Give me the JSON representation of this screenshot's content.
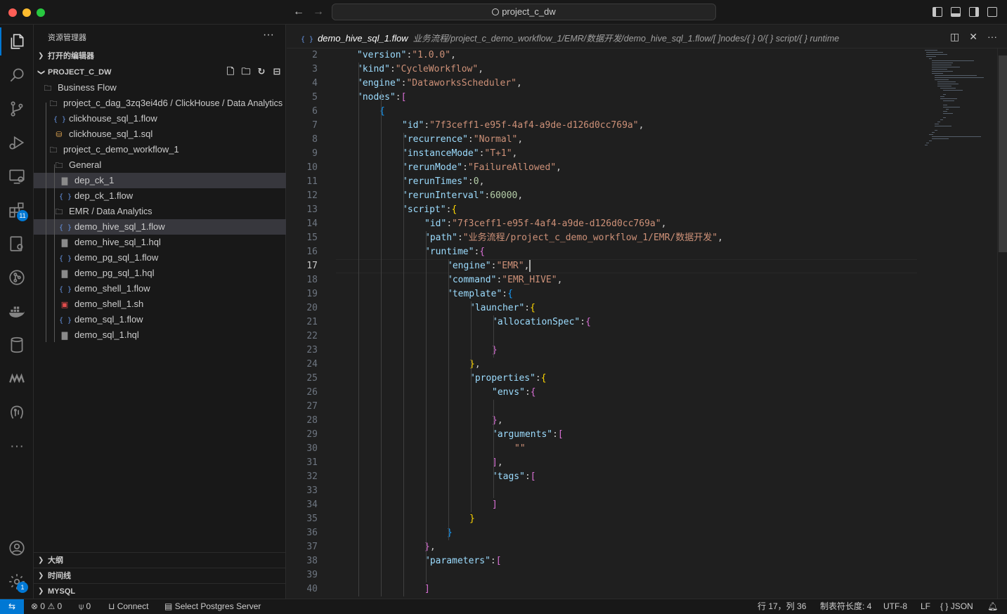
{
  "window": {
    "search_text": "project_c_dw"
  },
  "activity": {
    "extensions_badge": "11",
    "settings_badge": "1"
  },
  "sidebar": {
    "title": "资源管理器",
    "open_editors": "打开的编辑器",
    "project": "PROJECT_C_DW",
    "outline": "大纲",
    "timeline": "时间线",
    "mysql": "MYSQL",
    "tree": [
      {
        "label": "Business Flow",
        "icon": "folder-icon"
      },
      {
        "label": "project_c_dag_3zq3ei4d6",
        "sub": " / ClickHouse / Data Analytics",
        "icon": "folder-icon"
      },
      {
        "label": "clickhouse_sql_1.flow",
        "icon": "json-icon"
      },
      {
        "label": "clickhouse_sql_1.sql",
        "icon": "database-icon"
      },
      {
        "label": "project_c_demo_workflow_1",
        "icon": "folder-icon"
      },
      {
        "label": "General",
        "icon": "folder-icon"
      },
      {
        "label": "dep_ck_1",
        "icon": "file-icon"
      },
      {
        "label": "dep_ck_1.flow",
        "icon": "json-icon"
      },
      {
        "label": "EMR",
        "sub": " / Data Analytics",
        "icon": "folder-icon"
      },
      {
        "label": "demo_hive_sql_1.flow",
        "icon": "json-icon"
      },
      {
        "label": "demo_hive_sql_1.hql",
        "icon": "file-icon"
      },
      {
        "label": "demo_pg_sql_1.flow",
        "icon": "json-icon"
      },
      {
        "label": "demo_pg_sql_1.hql",
        "icon": "file-icon"
      },
      {
        "label": "demo_shell_1.flow",
        "icon": "json-icon"
      },
      {
        "label": "demo_shell_1.sh",
        "icon": "shell-icon"
      },
      {
        "label": "demo_sql_1.flow",
        "icon": "json-icon"
      },
      {
        "label": "demo_sql_1.hql",
        "icon": "file-icon"
      }
    ]
  },
  "editor": {
    "file_name": "demo_hive_sql_1.flow",
    "breadcrumb_path": "业务流程/project_c_demo_workflow_1/EMR/数据开发/demo_hive_sql_1.flow/[ ]nodes/{ } 0/{ } script/{ } runtime",
    "current_line": "17",
    "lines": [
      {
        "n": "2",
        "indent": 1,
        "tokens": [
          [
            "k",
            "\"version\""
          ],
          [
            "p",
            ":"
          ],
          [
            "s",
            "\"1.0.0\""
          ],
          [
            "p",
            ","
          ]
        ]
      },
      {
        "n": "3",
        "indent": 1,
        "tokens": [
          [
            "k",
            "\"kind\""
          ],
          [
            "p",
            ":"
          ],
          [
            "s",
            "\"CycleWorkflow\""
          ],
          [
            "p",
            ","
          ]
        ]
      },
      {
        "n": "4",
        "indent": 1,
        "tokens": [
          [
            "k",
            "\"engine\""
          ],
          [
            "p",
            ":"
          ],
          [
            "s",
            "\"DataworksScheduler\""
          ],
          [
            "p",
            ","
          ]
        ]
      },
      {
        "n": "5",
        "indent": 1,
        "tokens": [
          [
            "k",
            "\"nodes\""
          ],
          [
            "p",
            ":"
          ],
          [
            "b2",
            "["
          ]
        ]
      },
      {
        "n": "6",
        "indent": 2,
        "tokens": [
          [
            "b3",
            "{"
          ]
        ]
      },
      {
        "n": "7",
        "indent": 3,
        "tokens": [
          [
            "k",
            "\"id\""
          ],
          [
            "p",
            ":"
          ],
          [
            "s",
            "\"7f3ceff1-e95f-4af4-a9de-d126d0cc769a\""
          ],
          [
            "p",
            ","
          ]
        ]
      },
      {
        "n": "8",
        "indent": 3,
        "tokens": [
          [
            "k",
            "\"recurrence\""
          ],
          [
            "p",
            ":"
          ],
          [
            "s",
            "\"Normal\""
          ],
          [
            "p",
            ","
          ]
        ]
      },
      {
        "n": "9",
        "indent": 3,
        "tokens": [
          [
            "k",
            "\"instanceMode\""
          ],
          [
            "p",
            ":"
          ],
          [
            "s",
            "\"T+1\""
          ],
          [
            "p",
            ","
          ]
        ]
      },
      {
        "n": "10",
        "indent": 3,
        "tokens": [
          [
            "k",
            "\"rerunMode\""
          ],
          [
            "p",
            ":"
          ],
          [
            "s",
            "\"FailureAllowed\""
          ],
          [
            "p",
            ","
          ]
        ]
      },
      {
        "n": "11",
        "indent": 3,
        "tokens": [
          [
            "k",
            "\"rerunTimes\""
          ],
          [
            "p",
            ":"
          ],
          [
            "n",
            "0"
          ],
          [
            "p",
            ","
          ]
        ]
      },
      {
        "n": "12",
        "indent": 3,
        "tokens": [
          [
            "k",
            "\"rerunInterval\""
          ],
          [
            "p",
            ":"
          ],
          [
            "n",
            "60000"
          ],
          [
            "p",
            ","
          ]
        ]
      },
      {
        "n": "13",
        "indent": 3,
        "tokens": [
          [
            "k",
            "\"script\""
          ],
          [
            "p",
            ":"
          ],
          [
            "b1",
            "{"
          ]
        ]
      },
      {
        "n": "14",
        "indent": 4,
        "tokens": [
          [
            "k",
            "\"id\""
          ],
          [
            "p",
            ":"
          ],
          [
            "s",
            "\"7f3ceff1-e95f-4af4-a9de-d126d0cc769a\""
          ],
          [
            "p",
            ","
          ]
        ]
      },
      {
        "n": "15",
        "indent": 4,
        "tokens": [
          [
            "k",
            "\"path\""
          ],
          [
            "p",
            ":"
          ],
          [
            "s",
            "\"业务流程/project_c_demo_workflow_1/EMR/数据开发\""
          ],
          [
            "p",
            ","
          ]
        ]
      },
      {
        "n": "16",
        "indent": 4,
        "tokens": [
          [
            "k",
            "\"runtime\""
          ],
          [
            "p",
            ":"
          ],
          [
            "b2",
            "{"
          ]
        ]
      },
      {
        "n": "17",
        "indent": 5,
        "tokens": [
          [
            "k",
            "\"engine\""
          ],
          [
            "p",
            ":"
          ],
          [
            "s",
            "\"EMR\""
          ],
          [
            "p",
            ","
          ]
        ],
        "cursor": true
      },
      {
        "n": "18",
        "indent": 5,
        "tokens": [
          [
            "k",
            "\"command\""
          ],
          [
            "p",
            ":"
          ],
          [
            "s",
            "\"EMR_HIVE\""
          ],
          [
            "p",
            ","
          ]
        ]
      },
      {
        "n": "19",
        "indent": 5,
        "tokens": [
          [
            "k",
            "\"template\""
          ],
          [
            "p",
            ":"
          ],
          [
            "b3",
            "{"
          ]
        ]
      },
      {
        "n": "20",
        "indent": 6,
        "tokens": [
          [
            "k",
            "\"launcher\""
          ],
          [
            "p",
            ":"
          ],
          [
            "b1",
            "{"
          ]
        ]
      },
      {
        "n": "21",
        "indent": 7,
        "tokens": [
          [
            "k",
            "\"allocationSpec\""
          ],
          [
            "p",
            ":"
          ],
          [
            "b2",
            "{"
          ]
        ]
      },
      {
        "n": "22",
        "indent": 0,
        "tokens": []
      },
      {
        "n": "23",
        "indent": 7,
        "tokens": [
          [
            "b2",
            "}"
          ]
        ]
      },
      {
        "n": "24",
        "indent": 6,
        "tokens": [
          [
            "b1",
            "}"
          ],
          [
            "p",
            ","
          ]
        ]
      },
      {
        "n": "25",
        "indent": 6,
        "tokens": [
          [
            "k",
            "\"properties\""
          ],
          [
            "p",
            ":"
          ],
          [
            "b1",
            "{"
          ]
        ]
      },
      {
        "n": "26",
        "indent": 7,
        "tokens": [
          [
            "k",
            "\"envs\""
          ],
          [
            "p",
            ":"
          ],
          [
            "b2",
            "{"
          ]
        ]
      },
      {
        "n": "27",
        "indent": 0,
        "tokens": []
      },
      {
        "n": "28",
        "indent": 7,
        "tokens": [
          [
            "b2",
            "}"
          ],
          [
            "p",
            ","
          ]
        ]
      },
      {
        "n": "29",
        "indent": 7,
        "tokens": [
          [
            "k",
            "\"arguments\""
          ],
          [
            "p",
            ":"
          ],
          [
            "b2",
            "["
          ]
        ]
      },
      {
        "n": "30",
        "indent": 8,
        "tokens": [
          [
            "s",
            "\"\""
          ]
        ]
      },
      {
        "n": "31",
        "indent": 7,
        "tokens": [
          [
            "b2",
            "]"
          ],
          [
            "p",
            ","
          ]
        ]
      },
      {
        "n": "32",
        "indent": 7,
        "tokens": [
          [
            "k",
            "\"tags\""
          ],
          [
            "p",
            ":"
          ],
          [
            "b2",
            "["
          ]
        ]
      },
      {
        "n": "33",
        "indent": 0,
        "tokens": []
      },
      {
        "n": "34",
        "indent": 7,
        "tokens": [
          [
            "b2",
            "]"
          ]
        ]
      },
      {
        "n": "35",
        "indent": 6,
        "tokens": [
          [
            "b1",
            "}"
          ]
        ]
      },
      {
        "n": "36",
        "indent": 5,
        "tokens": [
          [
            "b3",
            "}"
          ]
        ]
      },
      {
        "n": "37",
        "indent": 4,
        "tokens": [
          [
            "b2",
            "}"
          ],
          [
            "p",
            ","
          ]
        ]
      },
      {
        "n": "38",
        "indent": 4,
        "tokens": [
          [
            "k",
            "\"parameters\""
          ],
          [
            "p",
            ":"
          ],
          [
            "b2",
            "["
          ]
        ]
      },
      {
        "n": "39",
        "indent": 0,
        "tokens": []
      },
      {
        "n": "40",
        "indent": 4,
        "tokens": [
          [
            "b2",
            "]"
          ]
        ]
      }
    ]
  },
  "status": {
    "errors": "0",
    "warnings": "0",
    "ports": "0",
    "connect": "Connect",
    "postgres": "Select Postgres Server",
    "position": "行 17，列 36",
    "tab_size": "制表符长度: 4",
    "encoding": "UTF-8",
    "eol": "LF",
    "language": "JSON"
  },
  "colors": {
    "accent": "#0078d4",
    "key": "#9cdcfe",
    "string": "#ce9178",
    "number": "#b5cea8"
  }
}
